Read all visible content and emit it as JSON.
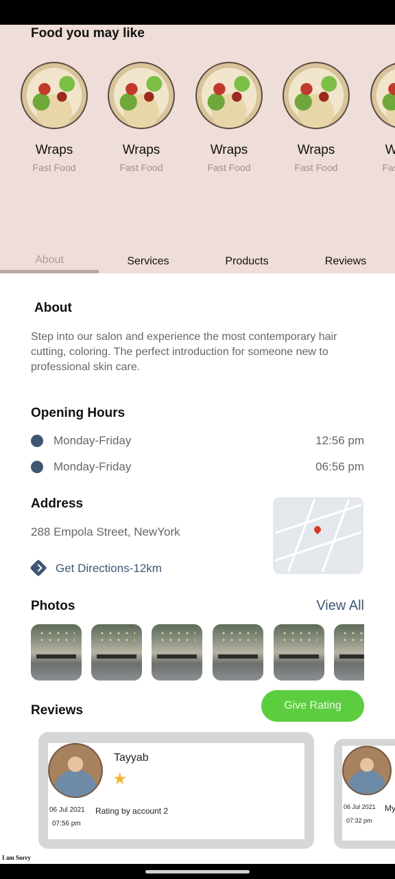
{
  "food_section": {
    "title": "Food you may like",
    "items": [
      {
        "name": "Wraps",
        "category": "Fast Food"
      },
      {
        "name": "Wraps",
        "category": "Fast Food"
      },
      {
        "name": "Wraps",
        "category": "Fast Food"
      },
      {
        "name": "Wraps",
        "category": "Fast Food"
      },
      {
        "name": "Wraps",
        "category": "Fast Food"
      }
    ]
  },
  "tabs": [
    {
      "label": "About",
      "active": true
    },
    {
      "label": "Services",
      "active": false
    },
    {
      "label": "Products",
      "active": false
    },
    {
      "label": "Reviews",
      "active": false
    }
  ],
  "about": {
    "title": "About",
    "text": "Step into our salon and experience the most contemporary hair cutting, coloring. The perfect introduction for someone new to professional skin care."
  },
  "opening_hours": {
    "title": "Opening Hours",
    "rows": [
      {
        "day": "Monday-Friday",
        "time": "12:56 pm"
      },
      {
        "day": "Monday-Friday",
        "time": "06:56 pm"
      }
    ]
  },
  "address": {
    "title": "Address",
    "text": "288 Empola Street, NewYork",
    "directions_label": "Get Directions-12km"
  },
  "photos": {
    "title": "Photos",
    "view_all_label": "View All",
    "count": 6
  },
  "reviews": {
    "title": "Reviews",
    "give_rating_label": "Give Rating",
    "items": [
      {
        "name": "Tayyab",
        "stars": 1,
        "date": "06 Jul 2021",
        "time": "07:56 pm",
        "text": "Rating by account 2"
      },
      {
        "name": "",
        "stars": 0,
        "date": "06 Jul 2021",
        "time": "07:32 pm",
        "text": "My"
      }
    ]
  },
  "toast": {
    "text": "I am Sorry"
  },
  "colors": {
    "header_bg": "#eeddd8",
    "accent_blue": "#3f5773",
    "rating_green": "#5ccd3f",
    "star": "#f2b637"
  },
  "icons": [
    "hours-dot-icon",
    "directions-icon",
    "star-icon",
    "map-pin-icon"
  ]
}
